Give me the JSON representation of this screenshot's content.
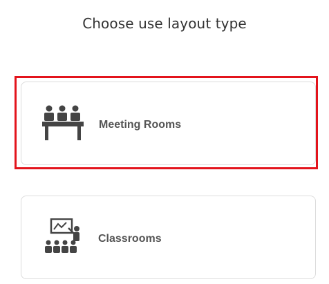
{
  "header": {
    "title": "Choose use layout type"
  },
  "options": [
    {
      "label": "Meeting Rooms",
      "icon": "meeting-room-icon",
      "selected": true
    },
    {
      "label": "Classrooms",
      "icon": "classroom-icon",
      "selected": false
    }
  ],
  "colors": {
    "selection_border": "#e3141c",
    "icon": "#444444",
    "card_border": "#dcdcdc"
  }
}
